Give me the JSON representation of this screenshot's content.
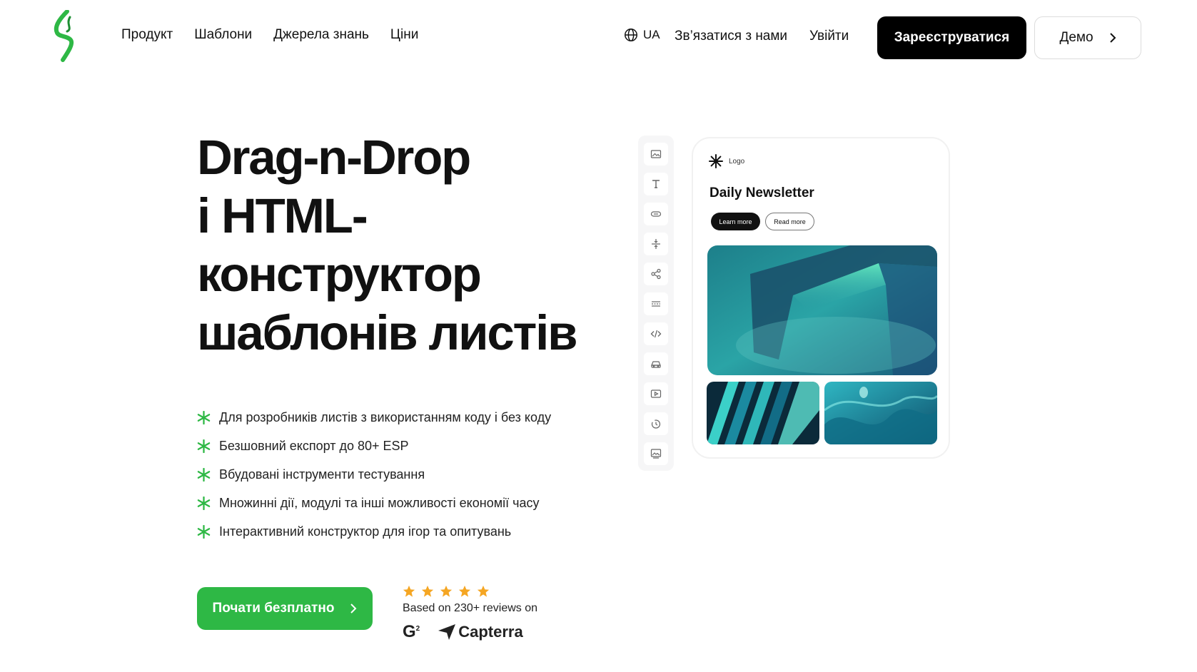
{
  "header": {
    "nav": [
      "Продукт",
      "Шаблони",
      "Джерела знань",
      "Ціни"
    ],
    "language": "UA",
    "contact": "Зв’язатися з нами",
    "login": "Увійти",
    "register": "Зареєструватися",
    "demo": "Демо"
  },
  "hero": {
    "title_lines": [
      "Drag-n-Drop",
      "і HTML-",
      "конструктор",
      "шаблонів листів"
    ],
    "features": [
      "Для розробників листів з використанням коду і без коду",
      "Безшовний експорт до 80+ ESP",
      "Вбудовані інструменти тестування",
      "Множинні дії, модулі та інші можливості економії часу",
      "Інтерактивний конструктор для ігор та опитувань"
    ],
    "cta": "Почати безплатно"
  },
  "reviews": {
    "rating_stars": 5,
    "text": "Based on 230+ reviews on",
    "g2": "G",
    "g2_sup": "2",
    "capterra": "Capterra"
  },
  "editor": {
    "tools": [
      "image-icon",
      "text-icon",
      "button-icon",
      "spacer-icon",
      "social-icon",
      "divider-icon",
      "code-icon",
      "menu-icon",
      "video-icon",
      "timer-icon",
      "banner-icon"
    ],
    "card": {
      "logo_text": "Logo",
      "title": "Daily Newsletter",
      "btn_primary": "Learn more",
      "btn_secondary": "Read more"
    }
  },
  "colors": {
    "brand_green": "#2eb845",
    "star_orange": "#f5a623",
    "dark": "#000000"
  }
}
